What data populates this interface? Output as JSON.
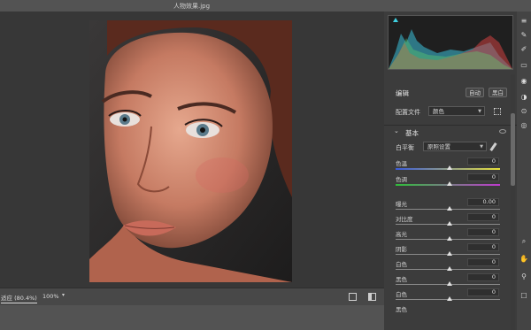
{
  "window": {
    "title": "人物效果.jpg"
  },
  "status_bar": {
    "zoom_fit": "适应 (80.4%)",
    "zoom_pct": "100%"
  },
  "edit": {
    "heading": "编辑",
    "auto_label": "自动",
    "bw_label": "黑白",
    "profile_label": "配置文件",
    "profile_value": "颜色"
  },
  "basic": {
    "heading": "基本",
    "wb_label": "白平衡",
    "wb_value": "原照设置",
    "sliders": [
      {
        "label": "色温",
        "value": "0"
      },
      {
        "label": "色调",
        "value": "0"
      },
      {
        "label": "曝光",
        "value": "0.00"
      },
      {
        "label": "对比度",
        "value": "0"
      },
      {
        "label": "高光",
        "value": "0"
      },
      {
        "label": "阴影",
        "value": "0"
      },
      {
        "label": "白色",
        "value": "0"
      },
      {
        "label": "黑色",
        "value": "0"
      },
      {
        "label": "白色",
        "value": "0"
      },
      {
        "label": "黑色",
        "value": ""
      }
    ]
  },
  "icons": {
    "histogram_clip": "triangle-warning-icon",
    "eye": "eye-icon",
    "picker": "eyedropper-icon",
    "grid": "profile-browser-icon"
  },
  "colors": {
    "panel_bg": "#3c3c3c",
    "canvas_bg": "#373737",
    "hist_blue": "#3ac0d8",
    "hist_red": "#d04040",
    "hist_green": "#5fd06f"
  }
}
